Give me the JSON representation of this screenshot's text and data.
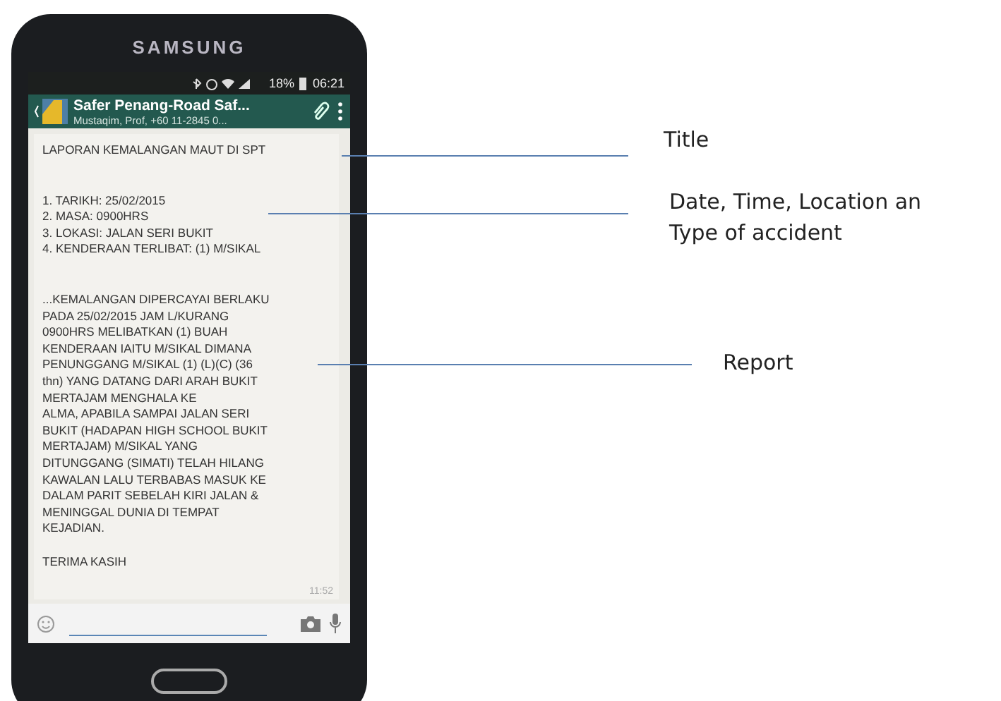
{
  "phone": {
    "brand": "SAMSUNG",
    "status_bar": {
      "battery": "18%",
      "time": "06:21"
    },
    "chat_header": {
      "title": "Safer Penang-Road Saf...",
      "subtitle": "Mustaqim, Prof, +60 11-2845 0..."
    },
    "message": {
      "title": "LAPORAN KEMALANGAN MAUT DI SPT",
      "details": [
        "1. TARIKH: 25/02/2015",
        "2. MASA: 0900HRS",
        "3. LOKASI: JALAN SERI BUKIT",
        "4. KENDERAAN TERLIBAT: (1) M/SIKAL"
      ],
      "report_lines": [
        "...KEMALANGAN DIPERCAYAI BERLAKU",
        "PADA 25/02/2015 JAM L/KURANG",
        "0900HRS MELIBATKAN (1) BUAH",
        "KENDERAAN IAITU M/SIKAL DIMANA",
        "PENUNGGANG M/SIKAL (1) (L)(C) (36",
        "thn) YANG DATANG DARI ARAH BUKIT",
        "MERTAJAM MENGHALA KE",
        "ALMA,  APABILA SAMPAI JALAN SERI",
        "BUKIT (HADAPAN HIGH SCHOOL BUKIT",
        "MERTAJAM) M/SIKAL YANG",
        "DITUNGGANG (SIMATI) TELAH HILANG",
        "KAWALAN LALU TERBABAS MASUK KE",
        "DALAM PARIT SEBELAH KIRI JALAN &",
        "MENINGGAL DUNIA DI TEMPAT",
        "KEJADIAN."
      ],
      "closing": "TERIMA KASIH",
      "time": "11:52"
    }
  },
  "annotations": [
    {
      "lines": [
        "Title"
      ]
    },
    {
      "lines": [
        "Date, Time, Location an",
        "Type of accident"
      ]
    },
    {
      "lines": [
        "Report"
      ]
    }
  ]
}
